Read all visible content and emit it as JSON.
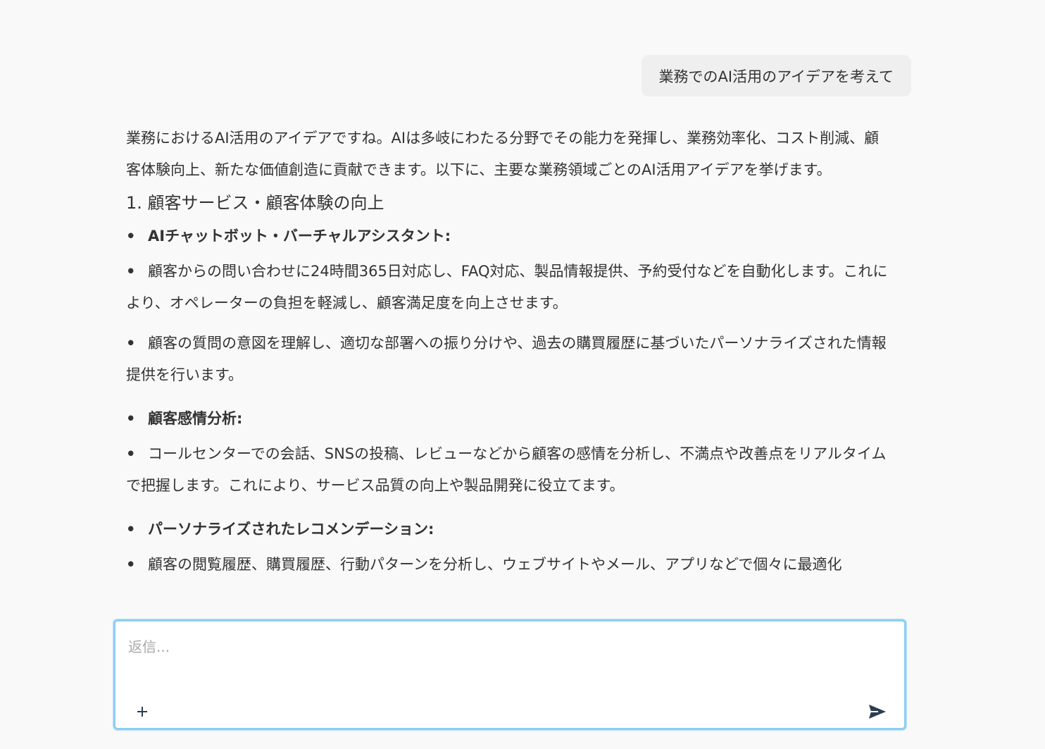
{
  "conversation": {
    "user_message": "業務でのAI活用のアイデアを考えて",
    "assistant": {
      "intro": "業務におけるAI活用のアイデアですね。AIは多岐にわたる分野でその能力を発揮し、業務効率化、コスト削減、顧客体験向上、新たな価値創造に貢献できます。以下に、主要な業務領域ごとのAI活用アイデアを挙げます。",
      "section_heading": "1. 顧客サービス・顧客体験の向上",
      "bullet_glyph": "•",
      "items": [
        {
          "label": "AIチャットボット・バーチャルアシスタント:"
        },
        {
          "text": "顧客からの問い合わせに24時間365日対応し、FAQ対応、製品情報提供、予約受付などを自動化します。これにより、オペレーターの負担を軽減し、顧客満足度を向上させます。"
        },
        {
          "text": "顧客の質問の意図を理解し、適切な部署への振り分けや、過去の購買履歴に基づいたパーソナライズされた情報提供を行います。"
        },
        {
          "label": "顧客感情分析:"
        },
        {
          "text": "コールセンターでの会話、SNSの投稿、レビューなどから顧客の感情を分析し、不満点や改善点をリアルタイムで把握します。これにより、サービス品質の向上や製品開発に役立てます。"
        },
        {
          "label": "パーソナライズされたレコメンデーション:"
        },
        {
          "text": "顧客の閲覧履歴、購買履歴、行動パターンを分析し、ウェブサイトやメール、アプリなどで個々に最適化"
        }
      ]
    }
  },
  "composer": {
    "placeholder": "返信...",
    "value": ""
  },
  "icons": {
    "attach": "plus-icon",
    "send": "send-icon"
  },
  "colors": {
    "background": "#f9f9f9",
    "user_bubble": "#efefef",
    "composer_border": "#8fcdf5",
    "text": "#333333",
    "send_icon": "#2c3e50"
  }
}
